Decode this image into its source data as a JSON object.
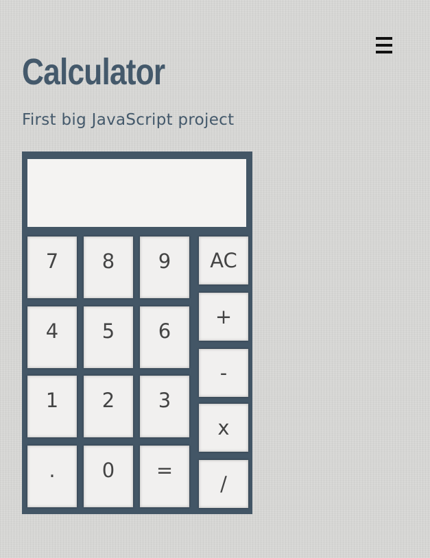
{
  "header": {
    "title": "Calculator",
    "subtitle": "First big JavaScript project",
    "menu_icon": "hamburger-menu-icon"
  },
  "calculator": {
    "display_value": "",
    "number_keys": [
      "7",
      "8",
      "9",
      "4",
      "5",
      "6",
      "1",
      "2",
      "3",
      ".",
      "0",
      "="
    ],
    "operator_keys": [
      "AC",
      "+",
      "-",
      "x",
      "/"
    ]
  },
  "colors": {
    "accent": "#44596b",
    "calculator_body": "#435666",
    "key_face": "#f1f0ef",
    "display": "#f4f3f2",
    "page_background": "#d6d6d4"
  }
}
